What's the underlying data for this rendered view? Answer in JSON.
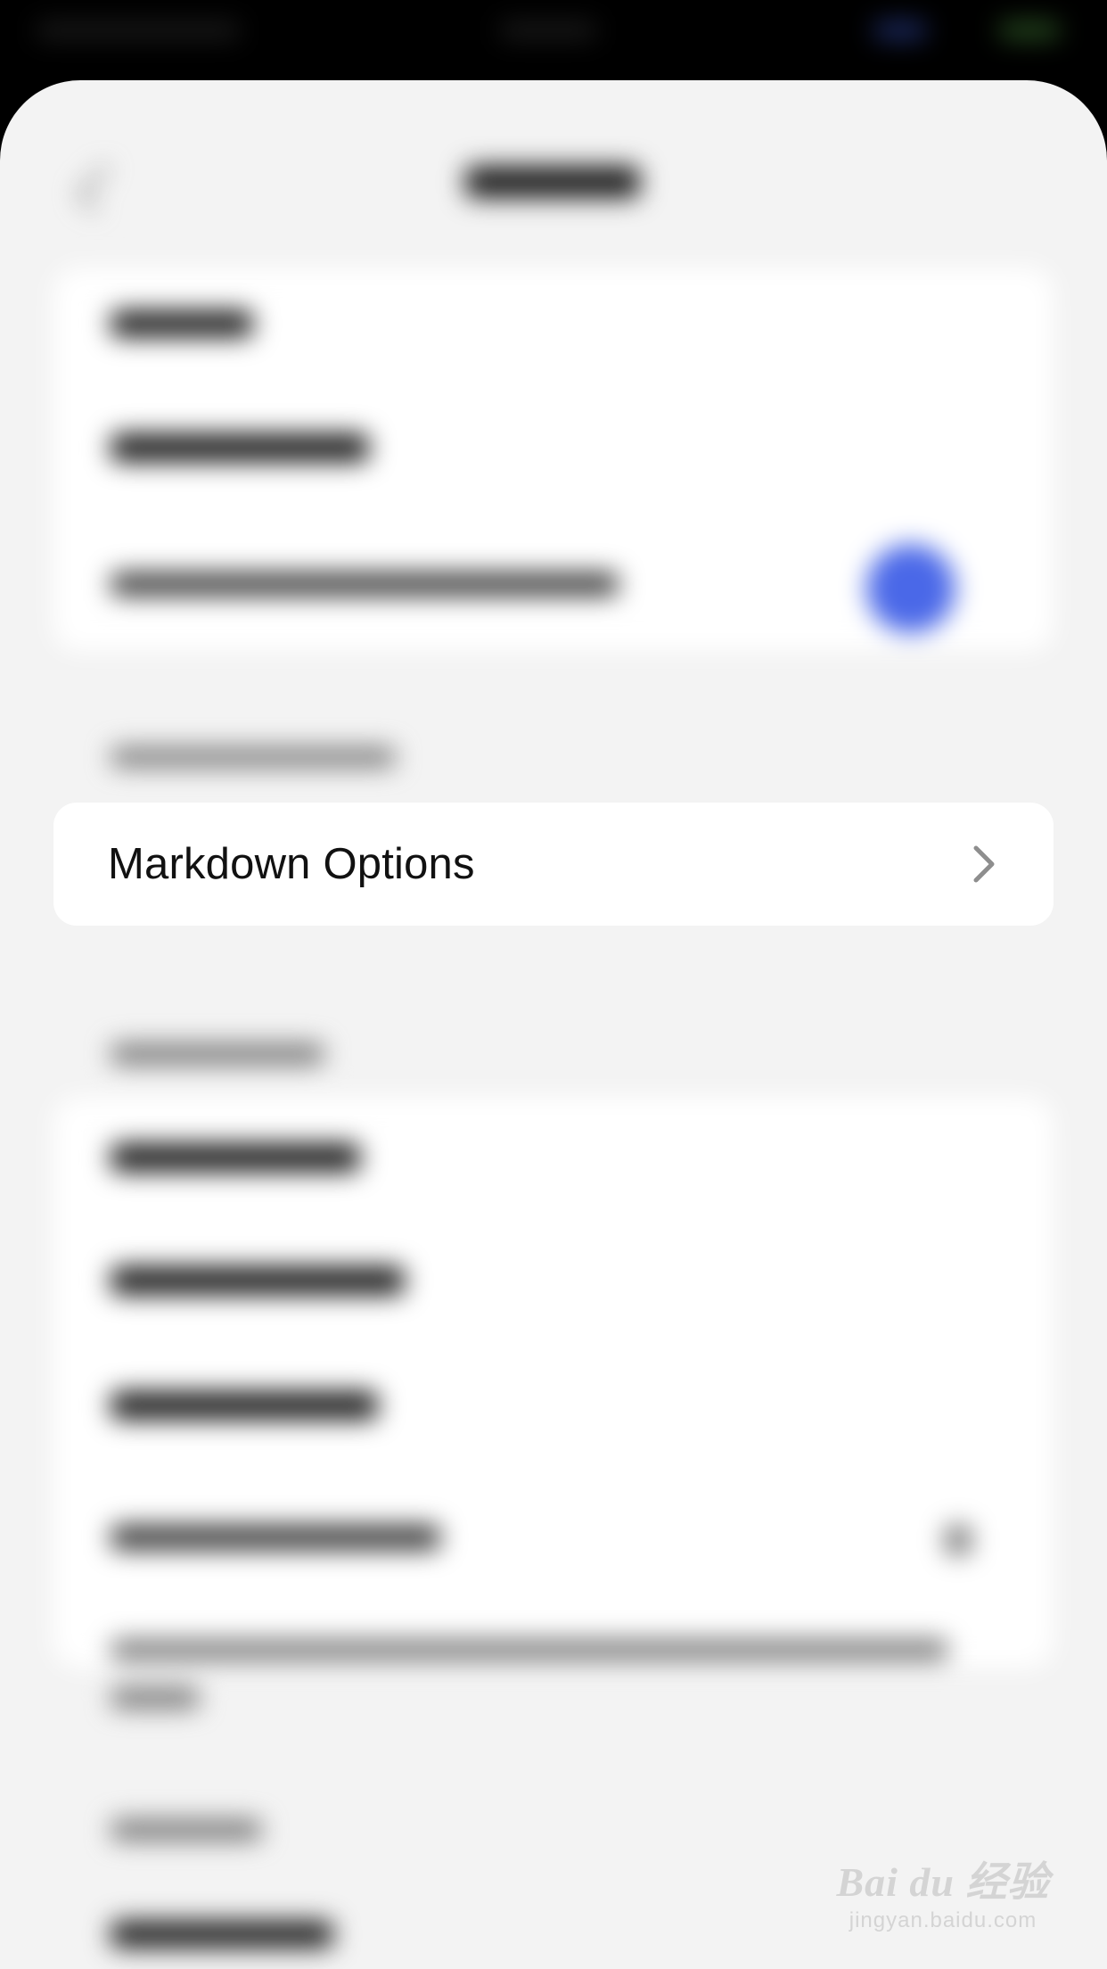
{
  "menu": {
    "markdown_options_label": "Markdown Options"
  },
  "watermark": {
    "brand": "Bai du 经验",
    "url": "jingyan.baidu.com"
  },
  "colors": {
    "sheet_background": "#f3f3f3",
    "card_background": "#ffffff",
    "toggle_accent": "#4a68e8",
    "chevron": "#8e8e8e"
  },
  "icons": {
    "chevron": "chevron-right-icon",
    "back": "back-icon"
  }
}
